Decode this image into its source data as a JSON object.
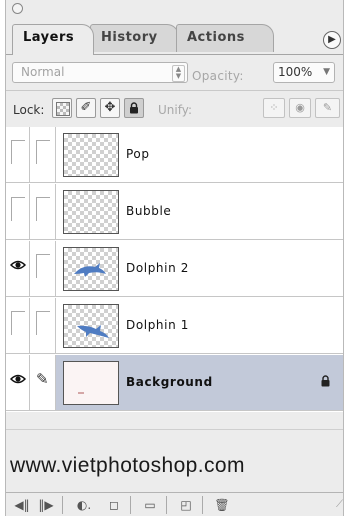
{
  "tabs": [
    {
      "label": "Layers",
      "active": true
    },
    {
      "label": "History",
      "active": false
    },
    {
      "label": "Actions",
      "active": false
    }
  ],
  "blend": {
    "mode": "Normal",
    "opacity_label": "Opacity:",
    "opacity_value": "100%"
  },
  "lock": {
    "label": "Lock:",
    "unify_label": "Unify:"
  },
  "layers": [
    {
      "name": "Pop",
      "visible": false,
      "thumbnail": "transparent",
      "selected": false
    },
    {
      "name": "Bubble",
      "visible": false,
      "thumbnail": "transparent",
      "selected": false
    },
    {
      "name": "Dolphin 2",
      "visible": true,
      "thumbnail": "dolphin",
      "selected": false
    },
    {
      "name": "Dolphin 1",
      "visible": false,
      "thumbnail": "dolphin",
      "selected": false
    },
    {
      "name": "Background",
      "visible": true,
      "thumbnail": "background",
      "selected": true,
      "locked": true,
      "paint_link": true
    }
  ],
  "watermark": "www.vietphotoshop.com",
  "icons": {
    "panel_menu": "panel-menu-icon",
    "eye": "eye-icon",
    "brush": "brush-icon",
    "lock": "padlock-icon"
  },
  "colors": {
    "selected_row": "#c2c9d9",
    "dolphin": "#4f7cc2"
  }
}
